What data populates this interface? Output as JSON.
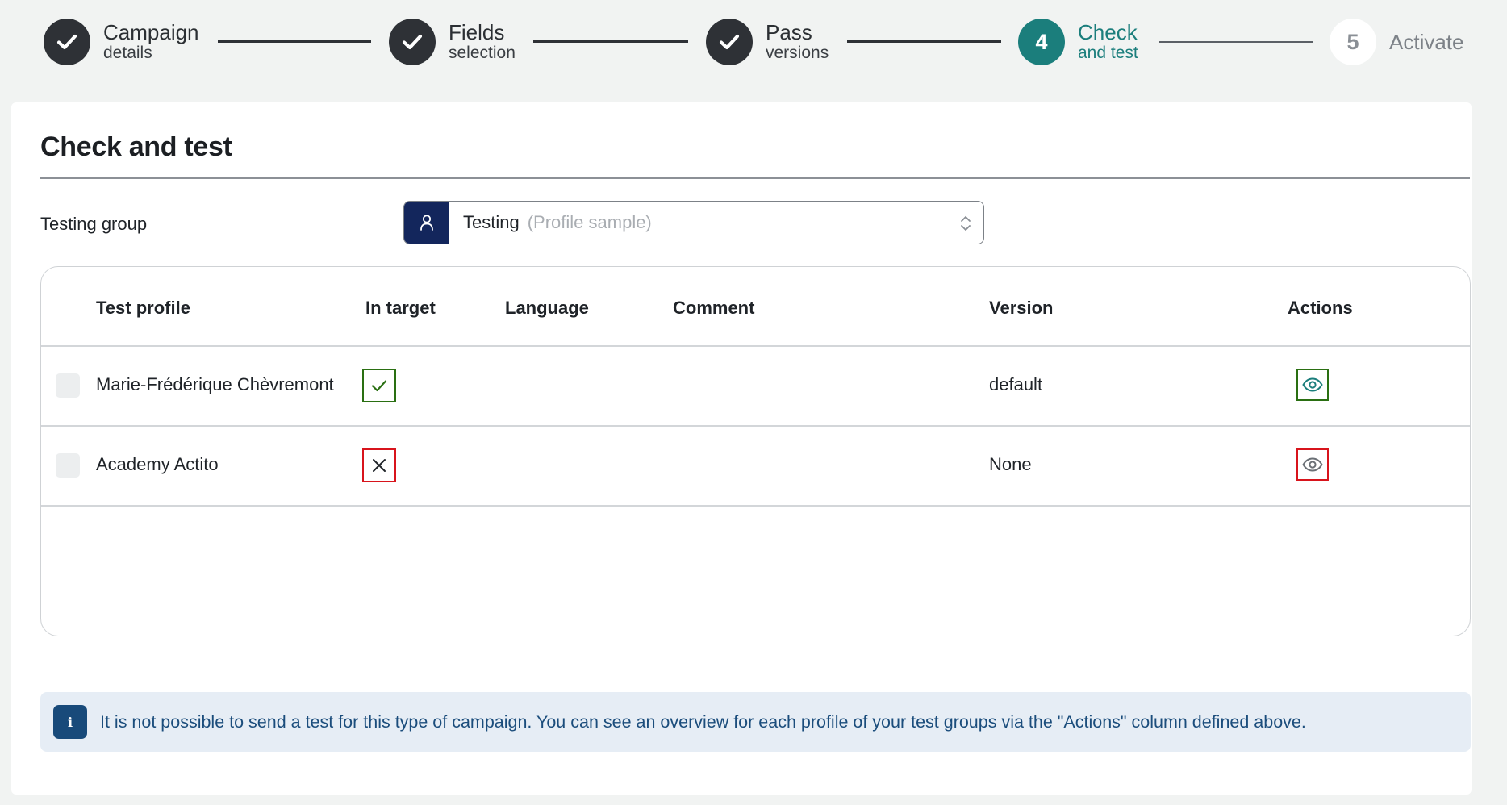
{
  "stepper": {
    "steps": [
      {
        "number": "1",
        "title": "Campaign",
        "subtitle": "details",
        "state": "done"
      },
      {
        "number": "2",
        "title": "Fields",
        "subtitle": "selection",
        "state": "done"
      },
      {
        "number": "3",
        "title": "Pass",
        "subtitle": "versions",
        "state": "done"
      },
      {
        "number": "4",
        "title": "Check",
        "subtitle": "and test",
        "state": "active"
      },
      {
        "number": "5",
        "title": "Activate",
        "subtitle": "",
        "state": "pending"
      }
    ]
  },
  "section": {
    "title": "Check and test"
  },
  "testing_group": {
    "label": "Testing group",
    "value": "Testing",
    "hint": "(Profile sample)",
    "icon": "user-icon"
  },
  "table": {
    "headers": {
      "profile": "Test profile",
      "in_target": "In target",
      "language": "Language",
      "comment": "Comment",
      "version": "Version",
      "actions": "Actions"
    },
    "rows": [
      {
        "profile": "Marie-Frédérique Chèvremont",
        "in_target": true,
        "language": "",
        "comment": "",
        "version": "default",
        "action_icon": "eye-icon"
      },
      {
        "profile": "Academy Actito",
        "in_target": false,
        "language": "",
        "comment": "",
        "version": "None",
        "action_icon": "eye-icon"
      }
    ]
  },
  "info": {
    "icon": "info-icon",
    "text": "It is not possible to send a test for this type of campaign. You can see an overview for each profile of your test groups via the \"Actions\" column defined above."
  },
  "colors": {
    "accent": "#1b7e7c",
    "done": "#2e3136",
    "ok": "#2a6f12",
    "error": "#d8141c",
    "navy": "#13265c"
  }
}
